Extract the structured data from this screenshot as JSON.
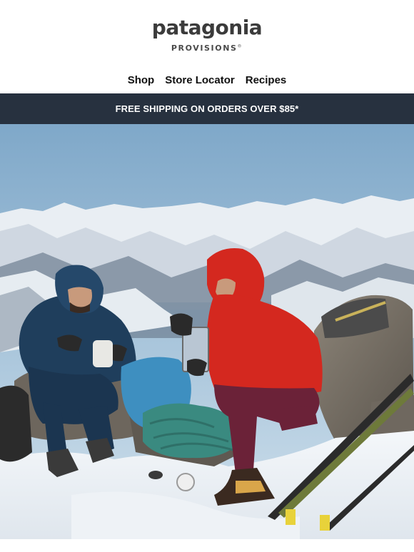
{
  "header": {
    "logo_text": "patagonia",
    "sub_logo_text": "PROVISIONS",
    "sub_logo_mark": "®"
  },
  "nav": {
    "items": [
      {
        "label": "Shop"
      },
      {
        "label": "Store Locator"
      },
      {
        "label": "Recipes"
      }
    ]
  },
  "banner": {
    "text": "FREE SHIPPING ON ORDERS OVER $85*"
  },
  "hero": {
    "description_icon": "hero-photo-icon"
  },
  "colors": {
    "banner_bg": "#27313f",
    "banner_text": "#ffffff",
    "red_jacket": "#d4281f",
    "blue_jacket": "#1f3e5c",
    "sky": "#a9c7de"
  }
}
